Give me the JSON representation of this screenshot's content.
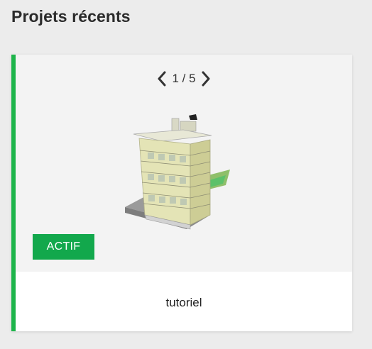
{
  "page": {
    "title": "Projets récents"
  },
  "project_card": {
    "pager": {
      "text": "1 / 5",
      "prev_icon": "chevron-left-icon",
      "next_icon": "chevron-right-icon"
    },
    "thumbnail_alt": "building-3d-model",
    "status_badge": "ACTIF",
    "project_name": "tutoriel"
  },
  "colors": {
    "accent": "#1db44a",
    "badge_bg": "#12a84c",
    "page_bg": "#ececec",
    "media_bg": "#f3f3f3"
  }
}
